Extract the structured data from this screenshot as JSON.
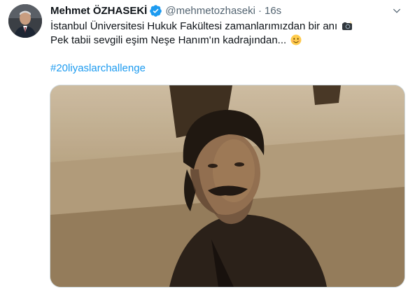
{
  "tweet": {
    "author": {
      "display_name": "Mehmet ÖZHASEKİ",
      "handle": "@mehmetozhaseki",
      "verified": true,
      "avatar_icon": "profile-photo"
    },
    "separator": "·",
    "timestamp": "16s",
    "text_line_1": "İstanbul Üniversitesi Hukuk Fakültesi zamanlarımızdan bir anı",
    "text_line_2": "Pek tabii sevgili eşim Neşe Hanım'ın kadrajından...",
    "emoji_1": "camera-with-flash-emoji",
    "emoji_2": "smiling-face-emoji",
    "hashtag": "#20liyaslarchallenge",
    "media_icon": "sepia-portrait-photo",
    "more_icon": "chevron-down-icon"
  },
  "colors": {
    "link": "#1d9bf0",
    "secondary_text": "#536471",
    "primary_text": "#0f1419",
    "verified_badge": "#1d9bf0"
  }
}
